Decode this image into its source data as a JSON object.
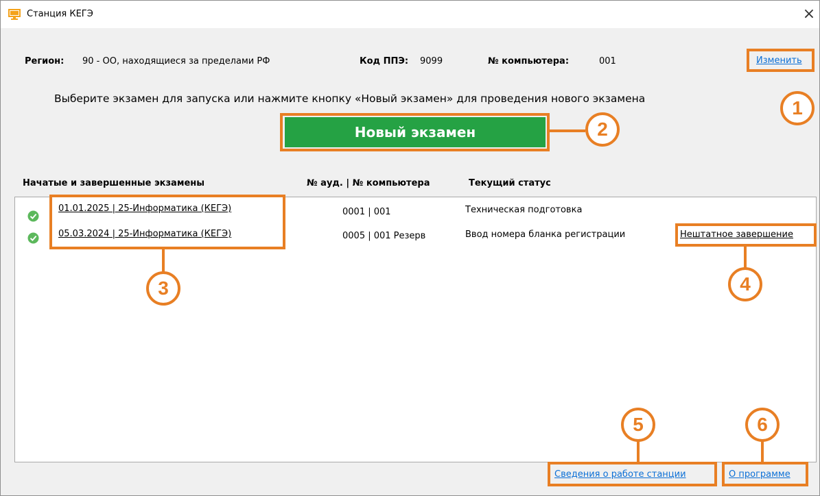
{
  "window": {
    "title": "Станция КЕГЭ"
  },
  "info": {
    "region_label": "Регион:",
    "region_value": "90 - ОО, находящиеся за пределами РФ",
    "ppe_label": "Код ППЭ:",
    "ppe_value": "9099",
    "computer_label": "№ компьютера:",
    "computer_value": "001",
    "change_link": "Изменить"
  },
  "instruction": "Выберите экзамен для запуска или нажмите кнопку «Новый экзамен» для проведения нового экзамена",
  "new_exam_button": "Новый экзамен",
  "table": {
    "headers": [
      "Начатые и завершенные экзамены",
      "№ ауд. | № компьютера",
      "Текущий статус"
    ],
    "rows": [
      {
        "exam": "01.01.2025 | 25-Информатика (КЕГЭ)",
        "room_computer": "0001 | 001",
        "status": "Техническая подготовка",
        "action": ""
      },
      {
        "exam": "05.03.2024 | 25-Информатика (КЕГЭ)",
        "room_computer": "0005 | 001 Резерв",
        "status": "Ввод номера бланка регистрации",
        "action": "Нештатное завершение"
      }
    ]
  },
  "footer": {
    "station_info_link": "Сведения о работе станции",
    "about_link": "О программе"
  },
  "callouts": [
    "1",
    "2",
    "3",
    "4",
    "5",
    "6"
  ],
  "colors": {
    "accent": "#e87f24",
    "button_green": "#25a244",
    "link": "#0b6fd6",
    "check_green": "#5cb85c"
  }
}
